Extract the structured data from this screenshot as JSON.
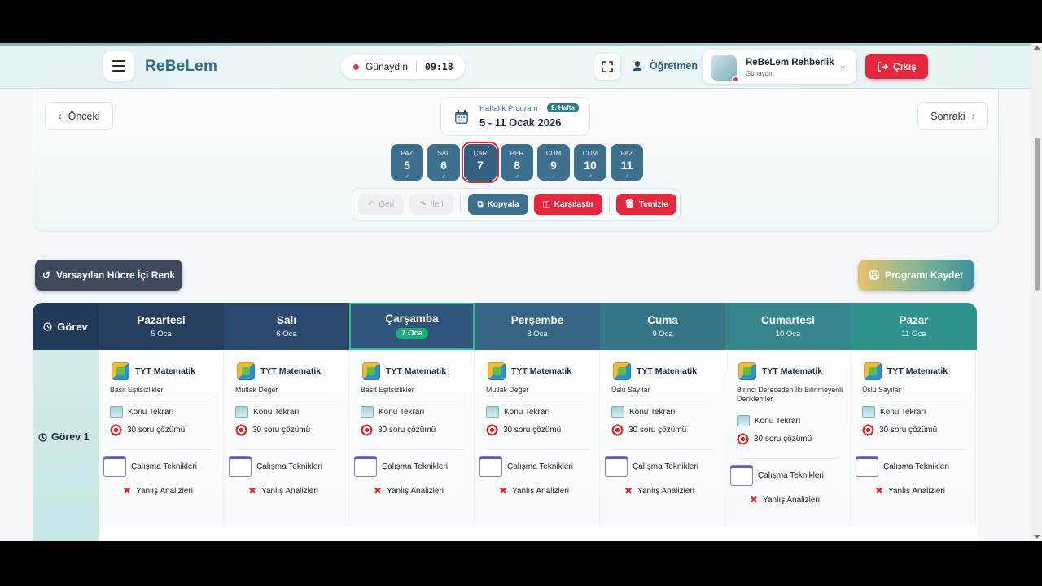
{
  "header": {
    "logo": "ReBeLem",
    "greeting": "Günaydın",
    "time": "09:18",
    "role": "Öğretmen",
    "profile_name": "ReBeLem Rehberlik",
    "profile_sub": "Günaydın",
    "exit_label": "Çıkış"
  },
  "week": {
    "prev_label": "Önceki",
    "next_label": "Sonraki",
    "program_label": "Haftalık Program",
    "week_badge": "2. Hafta",
    "range": "5 - 11 Ocak 2026",
    "days": [
      {
        "abbr": "PAZ",
        "num": "5"
      },
      {
        "abbr": "SAL",
        "num": "6"
      },
      {
        "abbr": "ÇAR",
        "num": "7"
      },
      {
        "abbr": "PER",
        "num": "8"
      },
      {
        "abbr": "CUM",
        "num": "9"
      },
      {
        "abbr": "CUM",
        "num": "10"
      },
      {
        "abbr": "PAZ",
        "num": "11"
      }
    ]
  },
  "toolbar": {
    "undo": "Geri",
    "redo": "İleri",
    "copy": "Kopyala",
    "compare": "Karşılaştır",
    "clear": "Temizle"
  },
  "actions": {
    "default_color": "Varsayılan Hücre İçi Renk",
    "save": "Programı Kaydet"
  },
  "table": {
    "corner": "Görev",
    "row_label": "Görev 1",
    "columns": [
      {
        "day": "Pazartesi",
        "date": "5 Oca"
      },
      {
        "day": "Salı",
        "date": "6 Oca"
      },
      {
        "day": "Çarşamba",
        "date": "7 Oca"
      },
      {
        "day": "Perşembe",
        "date": "8 Oca"
      },
      {
        "day": "Cuma",
        "date": "9 Oca"
      },
      {
        "day": "Cumartesi",
        "date": "10 Oca"
      },
      {
        "day": "Pazar",
        "date": "11 Oca"
      }
    ],
    "cells": [
      {
        "subject": "TYT Matematik",
        "topic": "Basit Eşitsizlikler",
        "review": "Konu Tekrarı",
        "solve": "30 soru çözümü",
        "technique": "Çalışma Teknikleri",
        "mistakes": "Yanlış Analizleri"
      },
      {
        "subject": "TYT Matematik",
        "topic": "Mutlak Değer",
        "review": "Konu Tekrarı",
        "solve": "30 soru çözümü",
        "technique": "Çalışma Teknikleri",
        "mistakes": "Yanlış Analizleri"
      },
      {
        "subject": "TYT Matematik",
        "topic": "Basit Eşitsizlikler",
        "review": "Konu Tekrarı",
        "solve": "30 soru çözümü",
        "technique": "Çalışma Teknikleri",
        "mistakes": "Yanlış Analizleri"
      },
      {
        "subject": "TYT Matematik",
        "topic": "Mutlak Değer",
        "review": "Konu Tekrarı",
        "solve": "30 soru çözümü",
        "technique": "Çalışma Teknikleri",
        "mistakes": "Yanlış Analizleri"
      },
      {
        "subject": "TYT Matematik",
        "topic": "Üslü Sayılar",
        "review": "Konu Tekrarı",
        "solve": "30 soru çözümü",
        "technique": "Çalışma Teknikleri",
        "mistakes": "Yanlış Analizleri"
      },
      {
        "subject": "TYT Matematik",
        "topic": "Birinci Dereceden İki Bilinmeyenli Denklemler",
        "review": "Konu Tekrarı",
        "solve": "30 soru çözümü",
        "technique": "Çalışma Teknikleri",
        "mistakes": "Yanlış Analizleri"
      },
      {
        "subject": "TYT Matematik",
        "topic": "Üslü Sayılar",
        "review": "Konu Tekrarı",
        "solve": "30 soru çözümü",
        "technique": "Çalışma Teknikleri",
        "mistakes": "Yanlış Analizleri"
      }
    ]
  },
  "colors": {
    "brand": "#2e6a8c",
    "danger": "#e5283e",
    "day_button": "#3d6f8e",
    "today_accent": "#22b07a"
  }
}
